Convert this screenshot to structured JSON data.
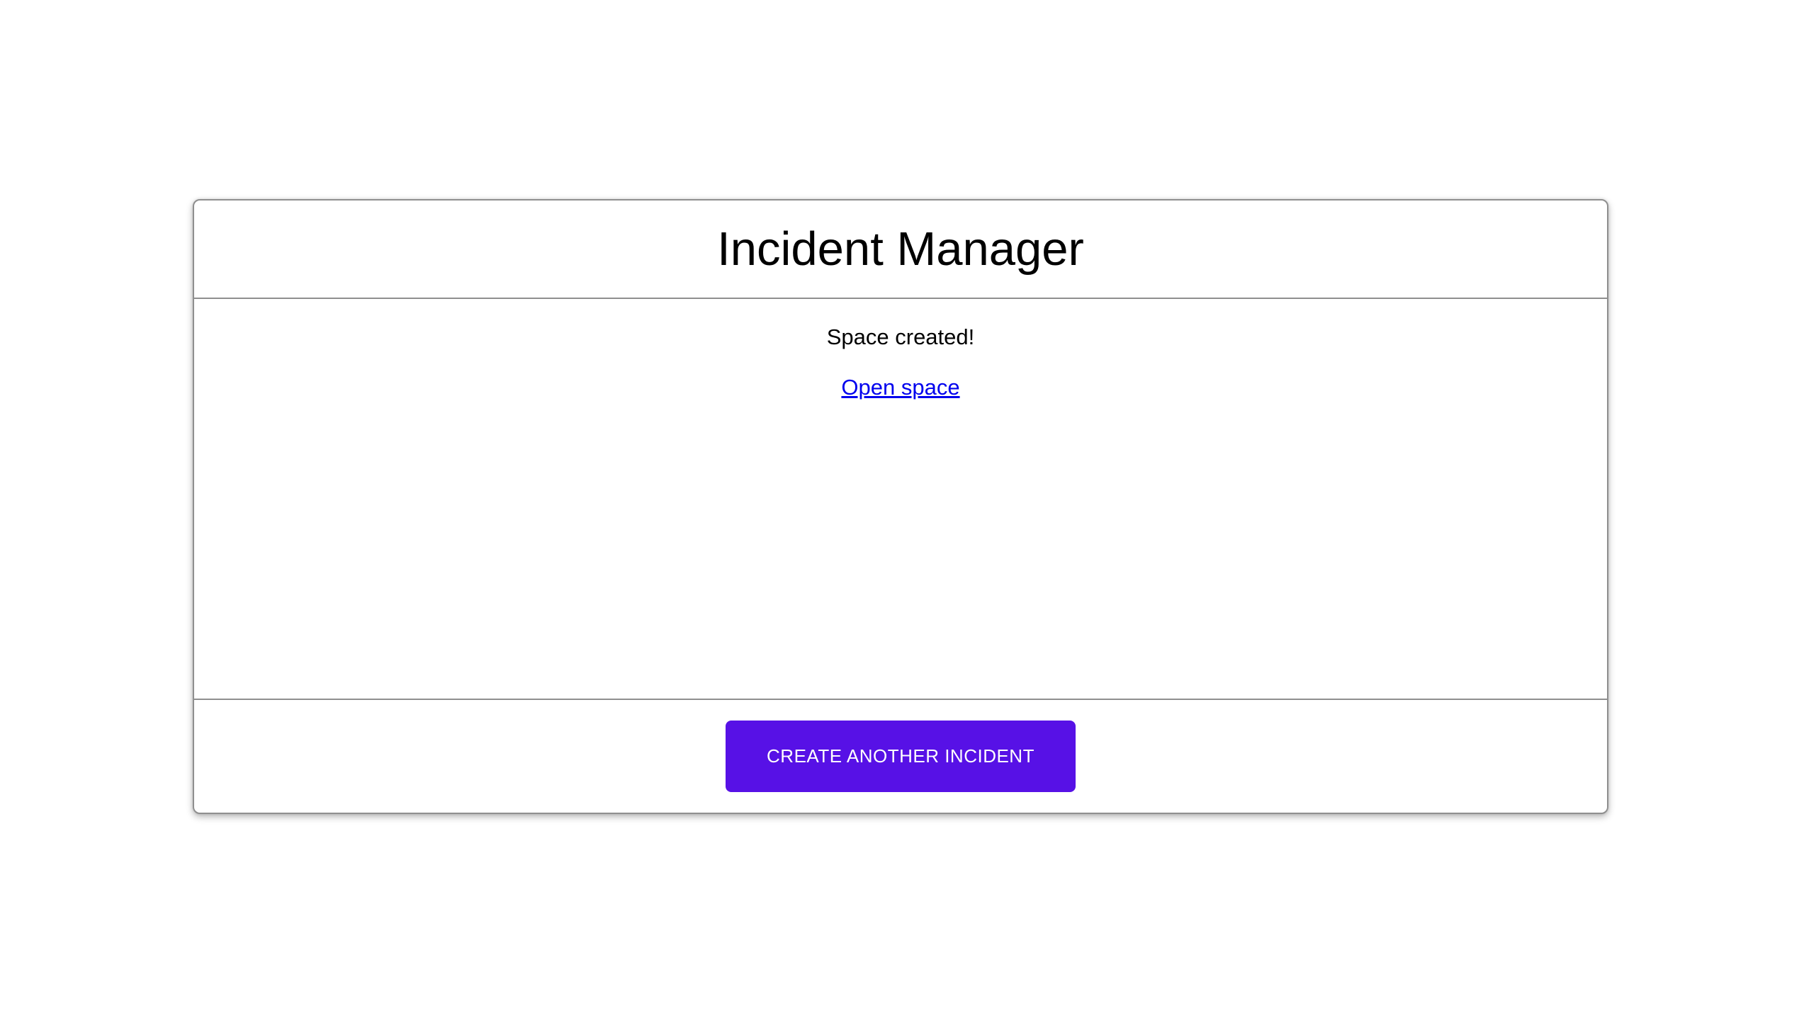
{
  "card": {
    "title": "Incident Manager",
    "body": {
      "status_message": "Space created!",
      "open_space_link": "Open space"
    },
    "actions": {
      "create_button": "CREATE ANOTHER INCIDENT"
    }
  },
  "colors": {
    "page_background": "#ffffff",
    "card_border": "#8f8f8f",
    "title_text": "#000000",
    "link": "#0000EE",
    "button_background": "#5711E6",
    "button_text": "#ffffff"
  }
}
